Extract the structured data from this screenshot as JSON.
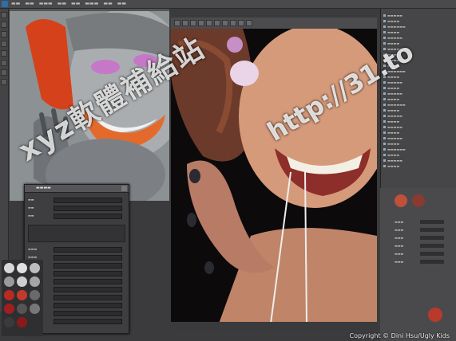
{
  "menubar": {
    "items": [
      "",
      "",
      "",
      "",
      "",
      "",
      "",
      "",
      "",
      "",
      "",
      ""
    ]
  },
  "viewport_left": {
    "label": "viewport-sculpt"
  },
  "viewport_right": {
    "label": "viewport-render"
  },
  "watermark": {
    "left_text": "xyz軟體補給站",
    "right_text": "http://31.to"
  },
  "footer": {
    "copyright": "Copyright © Dini Hsu/Ugly Kids"
  },
  "colors": {
    "accent": "#e0641e",
    "panel": "#464648",
    "viewport_bg": "#111111"
  }
}
